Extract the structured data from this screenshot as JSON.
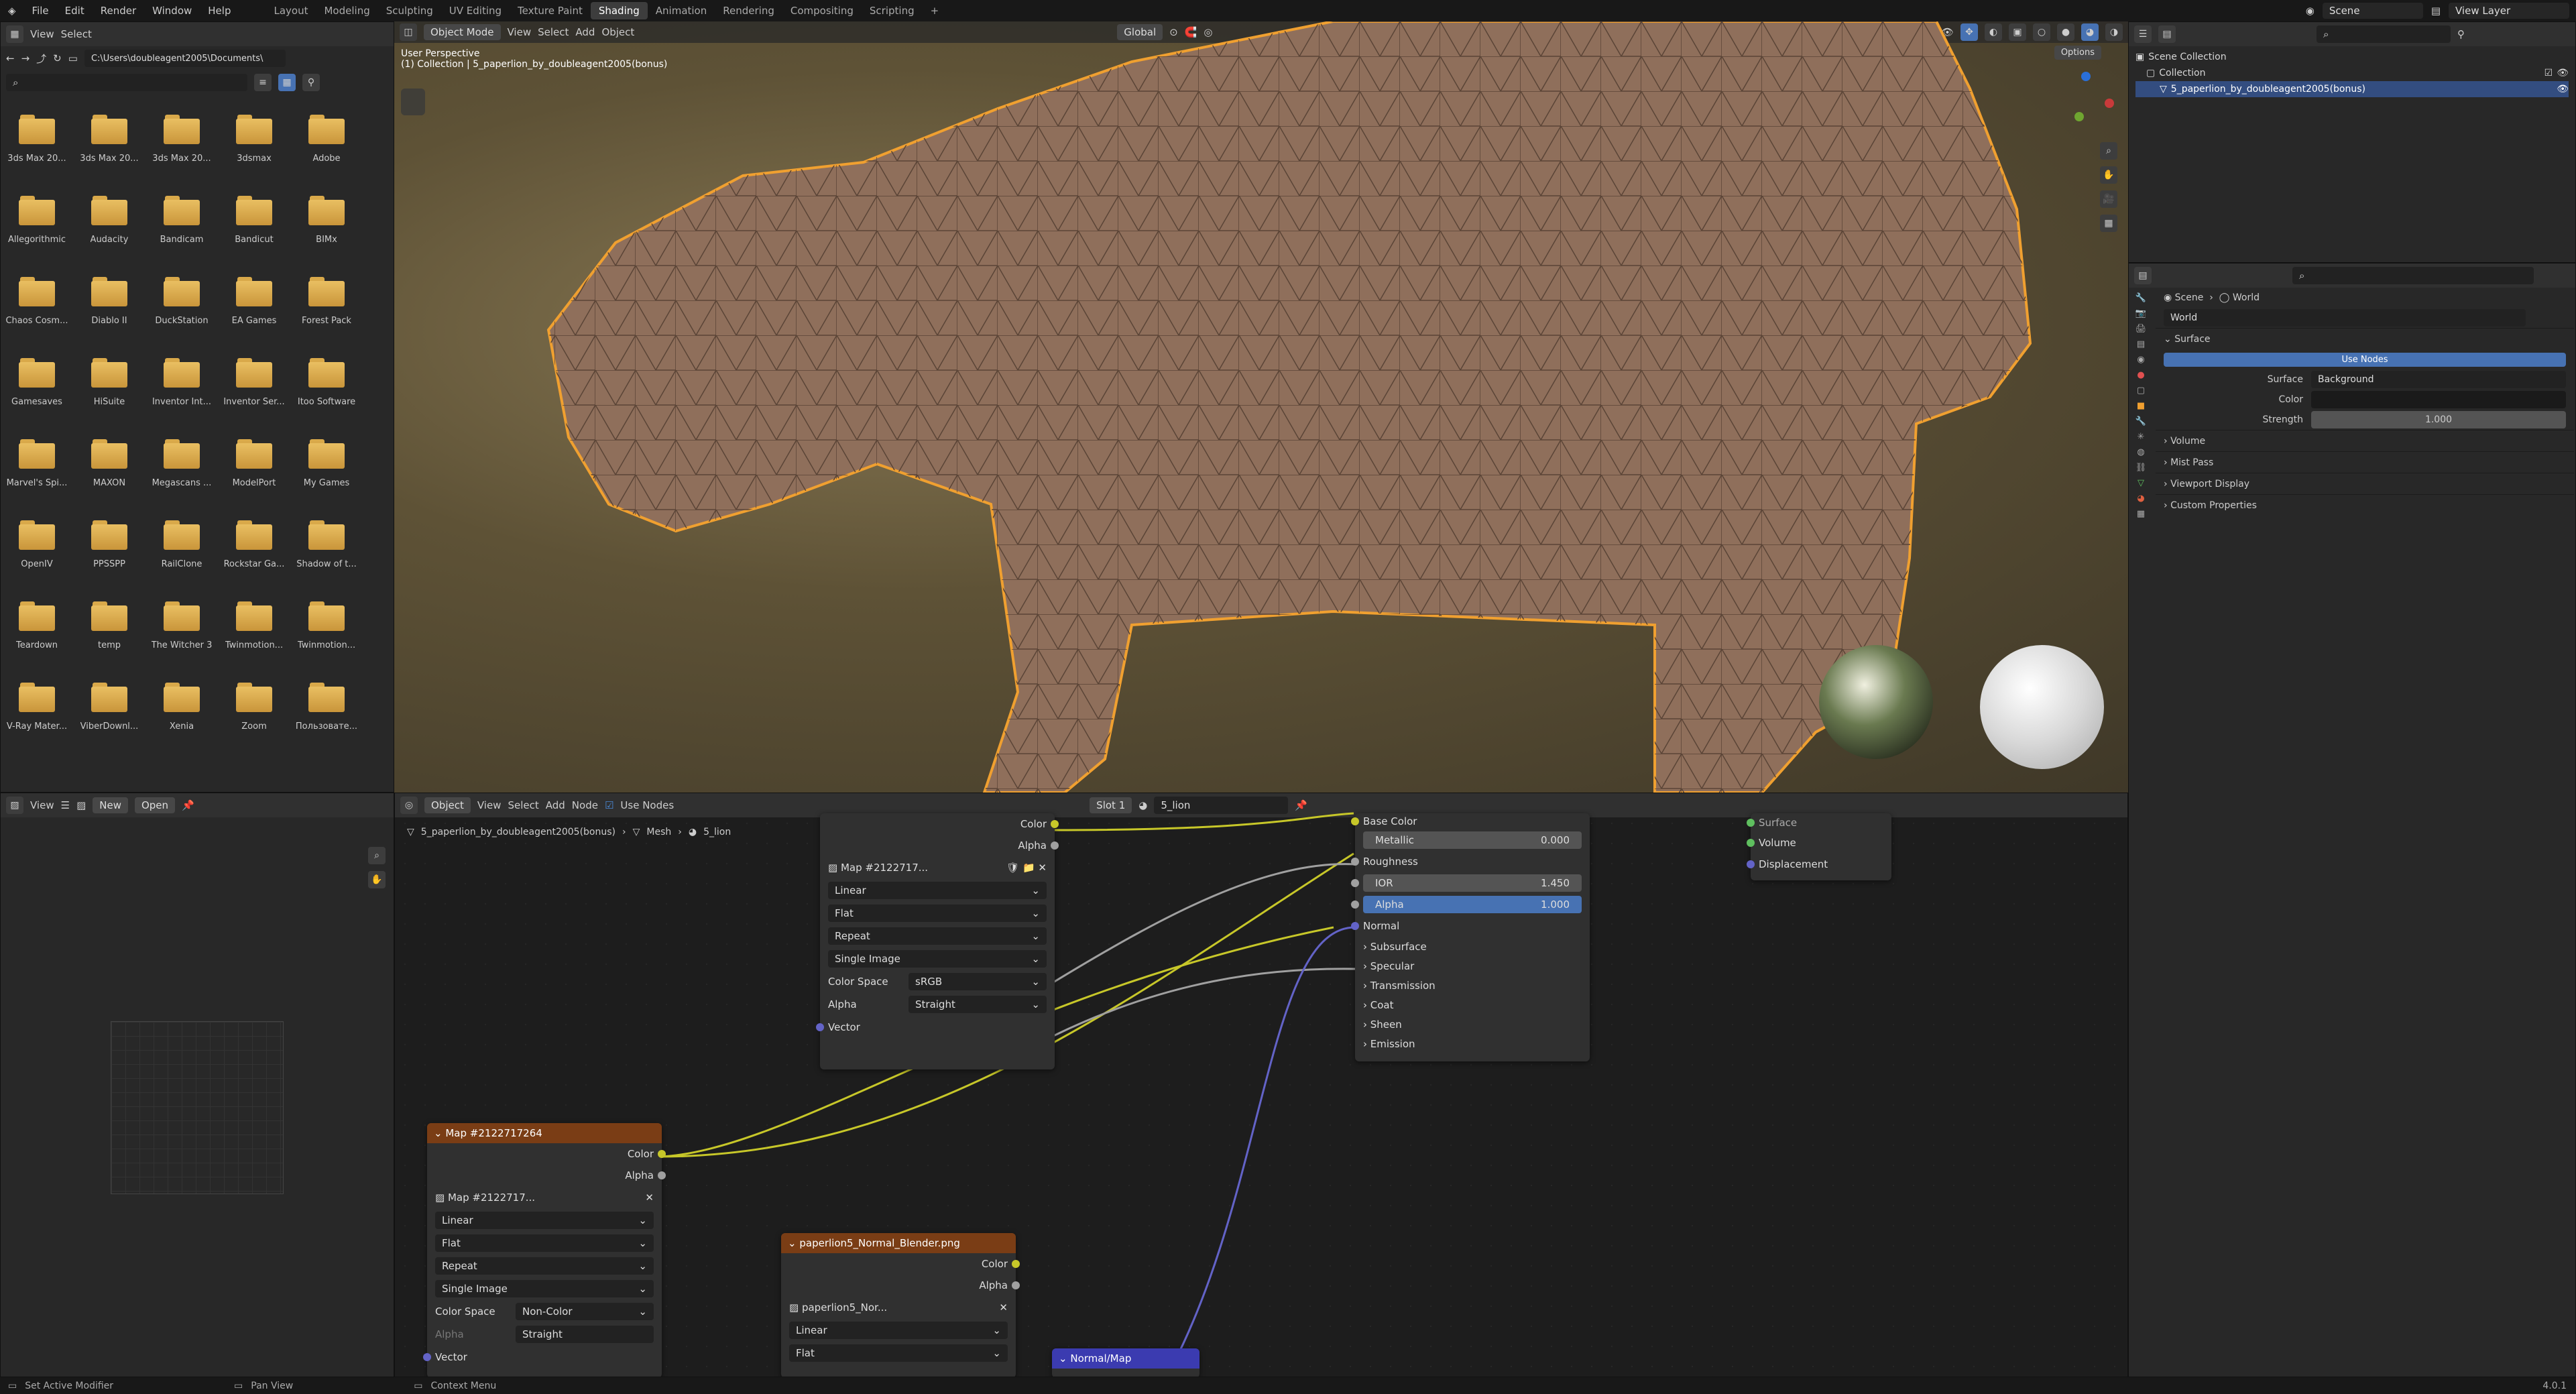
{
  "menu": [
    "File",
    "Edit",
    "Render",
    "Window",
    "Help"
  ],
  "workspaces": [
    "Layout",
    "Modeling",
    "Sculpting",
    "UV Editing",
    "Texture Paint",
    "Shading",
    "Animation",
    "Rendering",
    "Compositing",
    "Scripting"
  ],
  "active_workspace": "Shading",
  "scene": "Scene",
  "view_layer": "View Layer",
  "filebrowser": {
    "menu": [
      "View",
      "Select"
    ],
    "path": "C:\\Users\\doubleagent2005\\Documents\\",
    "folders": [
      "3ds Max 20...",
      "3ds Max 20...",
      "3ds Max 20...",
      "3dsmax",
      "Adobe",
      "Allegorithmic",
      "Audacity",
      "Bandicam",
      "Bandicut",
      "BIMx",
      "Chaos Cosm...",
      "Diablo II",
      "DuckStation",
      "EA Games",
      "Forest Pack",
      "Gamesaves",
      "HiSuite",
      "Inventor Int...",
      "Inventor Ser...",
      "Itoo Software",
      "Marvel's Spi...",
      "MAXON",
      "Megascans ...",
      "ModelPort",
      "My Games",
      "OpenIV",
      "PPSSPP",
      "RailClone",
      "Rockstar Ga...",
      "Shadow of t...",
      "Teardown",
      "temp",
      "The Witcher 3",
      "Twinmotion...",
      "Twinmotion...",
      "V-Ray Mater...",
      "ViberDownl...",
      "Xenia",
      "Zoom",
      "Пользовате..."
    ]
  },
  "viewport": {
    "mode": "Object Mode",
    "menu": [
      "View",
      "Select",
      "Add",
      "Object"
    ],
    "orientation": "Global",
    "perspective": "User Perspective",
    "collection": "(1) Collection | 5_paperlion_by_doubleagent2005(bonus)",
    "options": "Options"
  },
  "outliner": {
    "root": "Scene Collection",
    "collection": "Collection",
    "object": "5_paperlion_by_doubleagent2005(bonus)"
  },
  "properties": {
    "breadcrumb": [
      "Scene",
      "World"
    ],
    "world": "World",
    "surface_panel": "Surface",
    "use_nodes": "Use Nodes",
    "surface_label": "Surface",
    "surface_value": "Background",
    "color_label": "Color",
    "strength_label": "Strength",
    "strength_value": "1.000",
    "panels": [
      "Volume",
      "Mist Pass",
      "Viewport Display",
      "Custom Properties"
    ]
  },
  "image_editor": {
    "menu": [
      "View"
    ],
    "new": "New",
    "open": "Open"
  },
  "node_editor": {
    "object": "Object",
    "menu": [
      "View",
      "Select",
      "Add",
      "Node"
    ],
    "use_nodes": "Use Nodes",
    "slot": "Slot 1",
    "material": "5_lion",
    "breadcrumb": [
      "5_paperlion_by_doubleagent2005(bonus)",
      "Mesh",
      "5_lion"
    ]
  },
  "node_tex1": {
    "outputs": [
      "Color",
      "Alpha"
    ],
    "image": "Map #2122717...",
    "interp": "Linear",
    "proj": "Flat",
    "ext": "Repeat",
    "source": "Single Image",
    "cs_label": "Color Space",
    "cs": "sRGB",
    "alpha_label": "Alpha",
    "alpha": "Straight",
    "vector": "Vector"
  },
  "node_tex2": {
    "title": "Map #2122717264",
    "outputs": [
      "Color",
      "Alpha"
    ],
    "image": "Map #2122717...",
    "interp": "Linear",
    "proj": "Flat",
    "ext": "Repeat",
    "source": "Single Image",
    "cs_label": "Color Space",
    "cs": "Non-Color",
    "alpha_label": "Alpha",
    "alpha": "Straight",
    "vector": "Vector"
  },
  "node_tex3": {
    "title": "paperlion5_Normal_Blender.png",
    "outputs": [
      "Color",
      "Alpha"
    ],
    "image": "paperlion5_Nor...",
    "interp": "Linear",
    "proj": "Flat"
  },
  "node_normal": {
    "title": "Normal/Map"
  },
  "node_bsdf": {
    "base_color": "Base Color",
    "metallic": "Metallic",
    "metallic_v": "0.000",
    "roughness": "Roughness",
    "ior": "IOR",
    "ior_v": "1.450",
    "alpha": "Alpha",
    "alpha_v": "1.000",
    "normal": "Normal",
    "panels": [
      "Subsurface",
      "Specular",
      "Transmission",
      "Coat",
      "Sheen",
      "Emission"
    ]
  },
  "node_output": {
    "inputs": [
      "Surface",
      "Volume",
      "Displacement"
    ]
  },
  "status": {
    "a": "Set Active Modifier",
    "b": "Pan View",
    "c": "Context Menu",
    "version": "4.0.1"
  }
}
